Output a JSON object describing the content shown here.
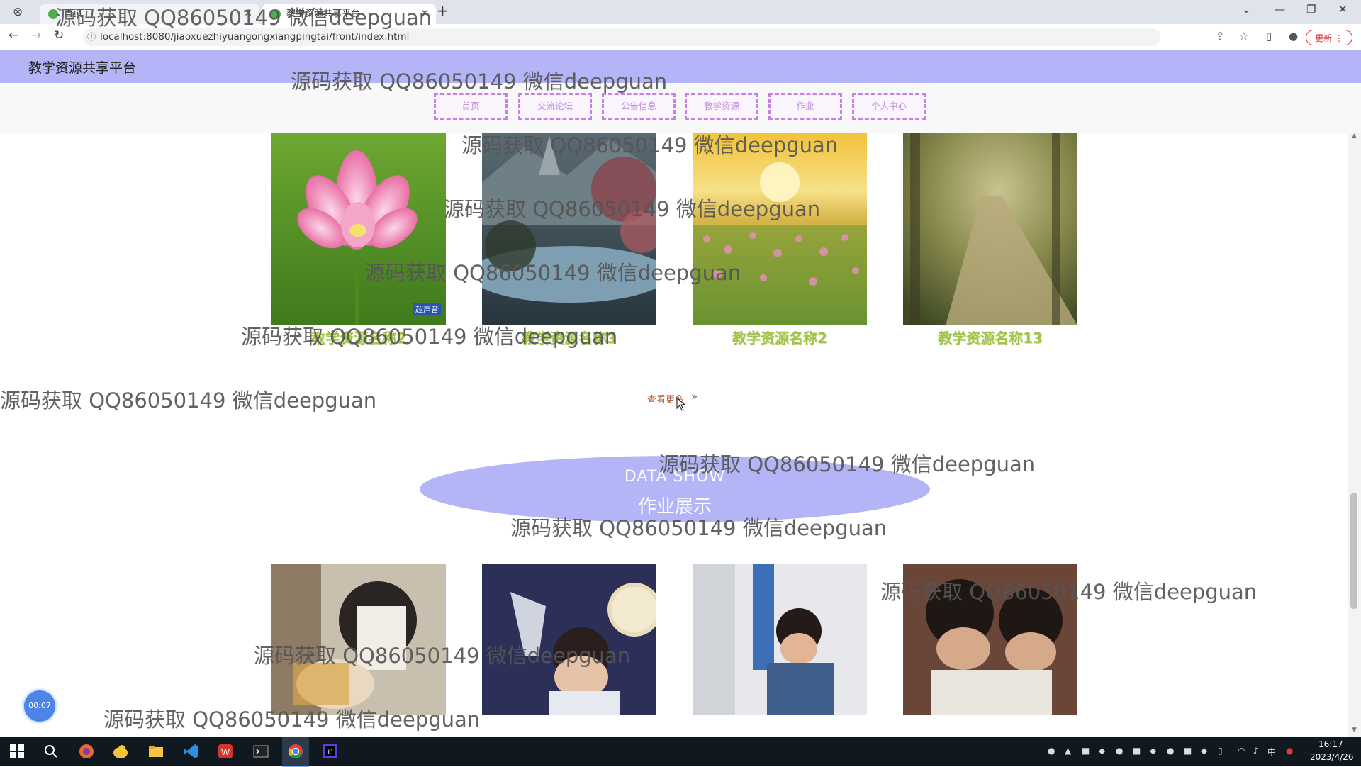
{
  "browser": {
    "tabs": [
      {
        "label": "首页"
      },
      {
        "label": "教学资源共享平台"
      }
    ],
    "new_tab": "+",
    "url": "localhost:8080/jiaoxuezhiyuangongxiangpingtai/front/index.html",
    "update_label": "更新"
  },
  "site": {
    "title": "教学资源共享平台",
    "nav": [
      "首页",
      "交流论坛",
      "公告信息",
      "教学资源",
      "作业",
      "个人中心"
    ]
  },
  "resources": {
    "items": [
      {
        "caption": "教学资源名称2",
        "thumb_text": "超声音"
      },
      {
        "caption": "教学资源名称3",
        "thumb_text": ""
      },
      {
        "caption": "教学资源名称2",
        "thumb_text": ""
      },
      {
        "caption": "教学资源名称13",
        "thumb_text": ""
      }
    ],
    "more_label": "查看更多",
    "more_arrow": "»"
  },
  "data_show": {
    "en": "DATA SHOW",
    "cn": "作业展示"
  },
  "timer_badge": "00:07",
  "watermark": "源码获取 QQ86050149 微信deepguan",
  "taskbar": {
    "time": "16:17",
    "date": "2023/4/26",
    "ime": "中"
  }
}
